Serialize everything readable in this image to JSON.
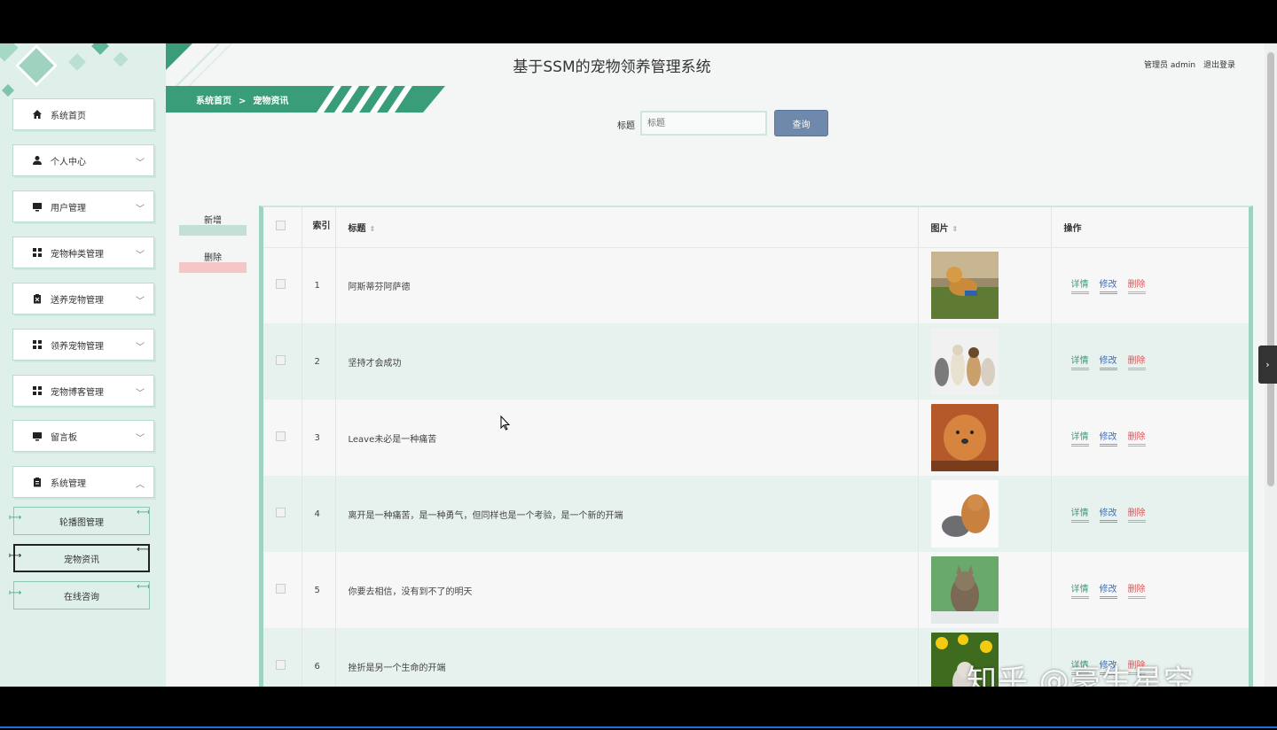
{
  "app": {
    "title": "基于SSM的宠物领养管理系统",
    "user_label": "管理员 admin",
    "logout_label": "退出登录"
  },
  "breadcrumb": {
    "home": "系统首页",
    "separator": ">",
    "current": "宠物资讯"
  },
  "sidebar": {
    "items": [
      {
        "label": "系统首页",
        "icon": "home-icon"
      },
      {
        "label": "个人中心",
        "icon": "user-icon"
      },
      {
        "label": "用户管理",
        "icon": "monitor-icon"
      },
      {
        "label": "宠物种类管理",
        "icon": "grid-icon"
      },
      {
        "label": "送养宠物管理",
        "icon": "clipboard-icon"
      },
      {
        "label": "领养宠物管理",
        "icon": "grid-icon"
      },
      {
        "label": "宠物博客管理",
        "icon": "grid-icon"
      },
      {
        "label": "留言板",
        "icon": "monitor-icon"
      },
      {
        "label": "系统管理",
        "icon": "clipboard-icon"
      }
    ],
    "subitems": [
      {
        "label": "轮播图管理"
      },
      {
        "label": "宠物资讯"
      },
      {
        "label": "在线咨询"
      }
    ]
  },
  "search": {
    "label": "标题",
    "placeholder": "标题",
    "button": "查询"
  },
  "actions": {
    "add": "新增",
    "delete": "删除"
  },
  "table": {
    "headers": {
      "index": "索引",
      "title": "标题",
      "image": "图片",
      "operations": "操作"
    },
    "op_labels": {
      "view": "详情",
      "edit": "修改",
      "remove": "删除"
    },
    "rows": [
      {
        "index": "1",
        "title": "阿斯蒂芬阿萨德",
        "image": "dog-on-grass"
      },
      {
        "index": "2",
        "title": "坚持才会成功",
        "image": "cats-and-dogs-group"
      },
      {
        "index": "3",
        "title": "Leave未必是一种痛苦",
        "image": "orange-puppy"
      },
      {
        "index": "4",
        "title": "离开是一种痛苦，是一种勇气，但同样也是一个考验，是一个新的开端",
        "image": "puppy-and-kitten"
      },
      {
        "index": "5",
        "title": "你要去相信，没有到不了的明天",
        "image": "kitten-on-green"
      },
      {
        "index": "6",
        "title": "挫折是另一个生命的开端",
        "image": "kitten-in-flowers"
      }
    ]
  },
  "watermark": "知乎 @豪生星空",
  "colors": {
    "accent": "#3a9d79",
    "sidebar_bg": "#dff0ea",
    "query_button": "#6f89ad",
    "delete_red": "#d6595b",
    "edit_blue": "#3b6fbf"
  }
}
